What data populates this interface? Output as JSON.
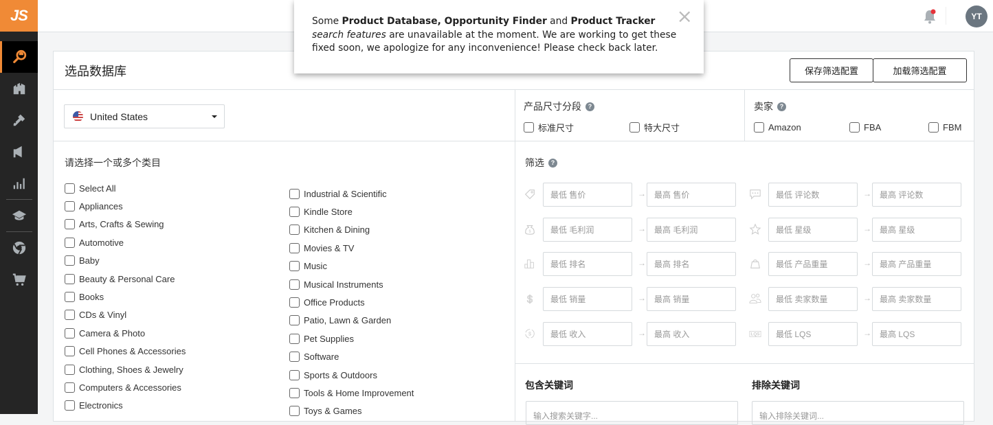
{
  "app": {
    "logo_text": "JS"
  },
  "sidebar": {
    "items": [
      {
        "name": "product-database",
        "icon": "search-icon",
        "active": true
      },
      {
        "name": "product-tracker",
        "icon": "castle-icon"
      },
      {
        "name": "keywords",
        "icon": "key-icon"
      },
      {
        "name": "launch",
        "icon": "megaphone-icon"
      },
      {
        "name": "sales-analytics",
        "icon": "bar-chart-icon"
      },
      {
        "name": "academy",
        "icon": "graduation-cap-icon"
      },
      {
        "name": "extension",
        "icon": "chrome-icon"
      },
      {
        "name": "supplier",
        "icon": "cart-icon"
      }
    ]
  },
  "topbar": {
    "avatar_initials": "YT",
    "notification_icon": "bell-icon",
    "notification_badge_color": "#e5323a"
  },
  "toast": {
    "parts": [
      {
        "text": "Some ",
        "style": "normal"
      },
      {
        "text": "Product Database, Opportunity Finder",
        "style": "bold"
      },
      {
        "text": " and ",
        "style": "normal"
      },
      {
        "text": "Product Tracker",
        "style": "bold"
      },
      {
        "text": " search features",
        "style": "italic"
      },
      {
        "text": " are unavailable at the moment. We are working to get these fixed soon, we apologize for any inconvenience! Please check back later.",
        "style": "normal"
      }
    ],
    "close_label": "×"
  },
  "panel": {
    "title": "选品数据库",
    "save_button": "保存筛选配置",
    "load_button": "加载筛选配置"
  },
  "country": {
    "selected": "United States"
  },
  "categories": {
    "title": "请选择一个或多个类目",
    "col1": [
      "Select All",
      "Appliances",
      "Arts, Crafts & Sewing",
      "Automotive",
      "Baby",
      "Beauty & Personal Care",
      "Books",
      "CDs & Vinyl",
      "Camera & Photo",
      "Cell Phones & Accessories",
      "Clothing, Shoes & Jewelry",
      "Computers & Accessories",
      "Electronics"
    ],
    "col2": [
      "Industrial & Scientific",
      "Kindle Store",
      "Kitchen & Dining",
      "Movies & TV",
      "Music",
      "Musical Instruments",
      "Office Products",
      "Patio, Lawn & Garden",
      "Pet Supplies",
      "Software",
      "Sports & Outdoors",
      "Tools & Home Improvement",
      "Toys & Games"
    ]
  },
  "size_tier": {
    "label": "产品尺寸分段",
    "options": [
      "标准尺寸",
      "特大尺寸"
    ]
  },
  "seller": {
    "label": "卖家",
    "options": [
      "Amazon",
      "FBA",
      "FBM"
    ]
  },
  "filters": {
    "label": "筛选",
    "left": [
      {
        "icon": "price-tag-icon",
        "min": "最低 售价",
        "max": "最高 售价"
      },
      {
        "icon": "money-bag-icon",
        "min": "最低 毛利润",
        "max": "最高 毛利润"
      },
      {
        "icon": "rank-bars-icon",
        "min": "最低 排名",
        "max": "最高 排名"
      },
      {
        "icon": "dollar-icon",
        "min": "最低 销量",
        "max": "最高 销量"
      },
      {
        "icon": "revenue-icon",
        "min": "最低 收入",
        "max": "最高 收入"
      }
    ],
    "right": [
      {
        "icon": "reviews-icon",
        "min": "最低 评论数",
        "max": "最高 评论数"
      },
      {
        "icon": "star-icon",
        "min": "最低 星级",
        "max": "最高 星级"
      },
      {
        "icon": "weight-bag-icon",
        "min": "最低 产品重量",
        "max": "最高 产品重量"
      },
      {
        "icon": "sellers-icon",
        "min": "最低 卖家数量",
        "max": "最高 卖家数量"
      },
      {
        "icon": "lqs-icon",
        "min": "最低 LQS",
        "max": "最高 LQS"
      }
    ],
    "arrow": "→"
  },
  "keywords": {
    "include_label": "包含关键词",
    "include_placeholder": "输入搜索关键字...",
    "exclude_label": "排除关键词",
    "exclude_placeholder": "输入排除关键词..."
  }
}
